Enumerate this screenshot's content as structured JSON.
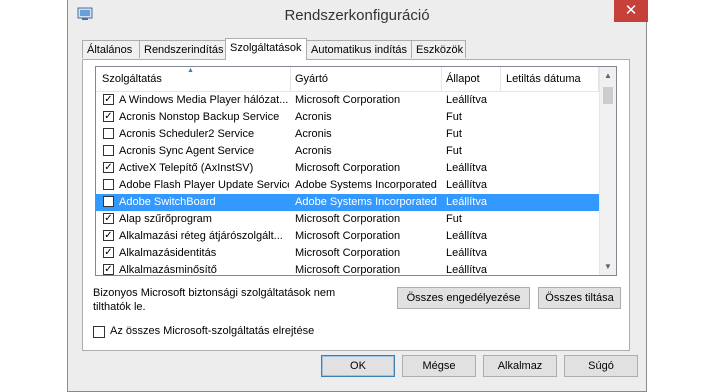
{
  "window": {
    "title": "Rendszerkonfiguráció",
    "close_glyph": "✕"
  },
  "tabs": [
    {
      "label": "Általános"
    },
    {
      "label": "Rendszerindítás"
    },
    {
      "label": "Szolgáltatások",
      "active": true
    },
    {
      "label": "Automatikus indítás"
    },
    {
      "label": "Eszközök"
    }
  ],
  "columns": {
    "service": "Szolgáltatás",
    "manufacturer": "Gyártó",
    "status": "Állapot",
    "disabled_date": "Letiltás dátuma"
  },
  "services": [
    {
      "checked": true,
      "name": "A Windows Media Player hálózat...",
      "manufacturer": "Microsoft Corporation",
      "status": "Leállítva"
    },
    {
      "checked": true,
      "name": "Acronis Nonstop Backup Service",
      "manufacturer": "Acronis",
      "status": "Fut"
    },
    {
      "checked": false,
      "name": "Acronis Scheduler2 Service",
      "manufacturer": "Acronis",
      "status": "Fut"
    },
    {
      "checked": false,
      "name": "Acronis Sync Agent Service",
      "manufacturer": "Acronis",
      "status": "Fut"
    },
    {
      "checked": true,
      "name": "ActiveX Telepítő (AxInstSV)",
      "manufacturer": "Microsoft Corporation",
      "status": "Leállítva"
    },
    {
      "checked": false,
      "name": "Adobe Flash Player Update Service",
      "manufacturer": "Adobe Systems Incorporated",
      "status": "Leállítva"
    },
    {
      "checked": false,
      "name": "Adobe SwitchBoard",
      "manufacturer": "Adobe Systems Incorporated",
      "status": "Leállítva",
      "selected": true
    },
    {
      "checked": true,
      "name": "Alap szűrőprogram",
      "manufacturer": "Microsoft Corporation",
      "status": "Fut"
    },
    {
      "checked": true,
      "name": "Alkalmazási réteg átjárószolgált...",
      "manufacturer": "Microsoft Corporation",
      "status": "Leállítva"
    },
    {
      "checked": true,
      "name": "Alkalmazásidentitás",
      "manufacturer": "Microsoft Corporation",
      "status": "Leállítva"
    },
    {
      "checked": true,
      "name": "Alkalmazásminősítő",
      "manufacturer": "Microsoft Corporation",
      "status": "Leállítva"
    }
  ],
  "note": "Bizonyos Microsoft biztonsági szolgáltatások nem tilthatók le.",
  "buttons": {
    "enable_all": "Összes engedélyezése",
    "disable_all": "Összes tiltása",
    "ok": "OK",
    "cancel": "Mégse",
    "apply": "Alkalmaz",
    "help": "Súgó"
  },
  "hide_ms": {
    "checked": false,
    "label": "Az összes Microsoft-szolgáltatás elrejtése"
  },
  "icons": {
    "check": "✓",
    "scroll_up": "▲",
    "scroll_down": "▼",
    "sort": "▲"
  },
  "colors": {
    "selection": "#3399ff",
    "close": "#c7403a"
  }
}
